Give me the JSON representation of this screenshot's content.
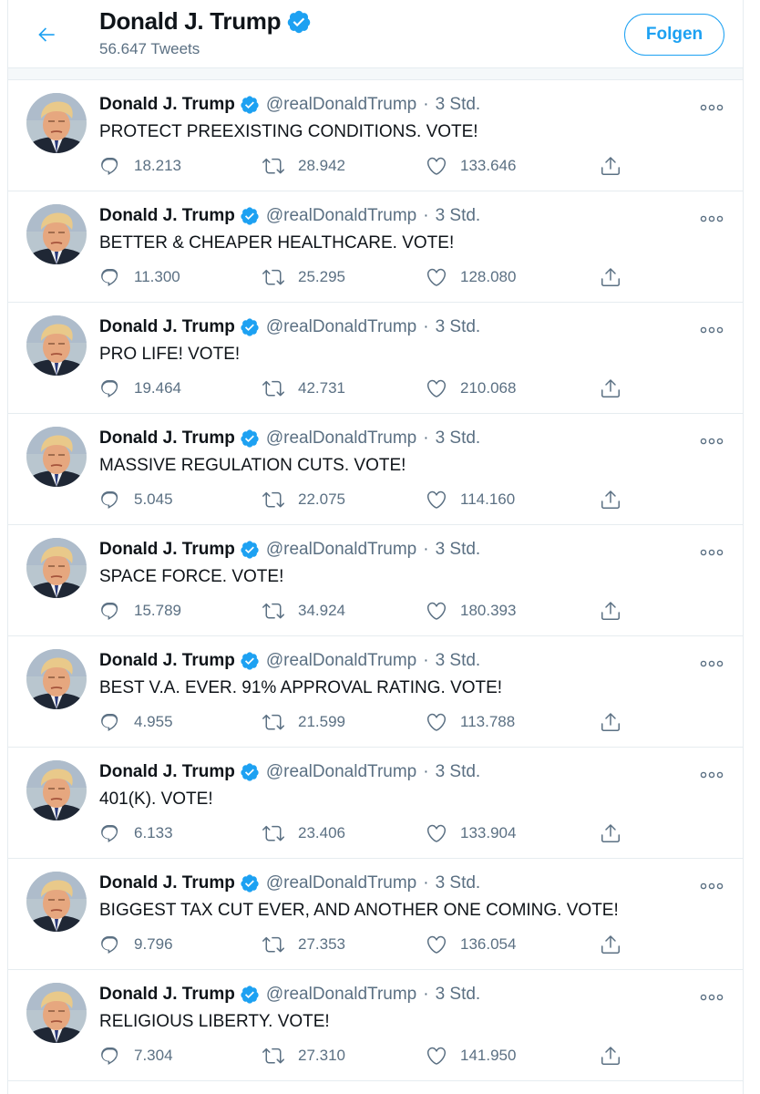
{
  "header": {
    "back_icon": "arrow-left-icon",
    "name": "Donald J. Trump",
    "verified_icon": "verified-badge-icon",
    "tweet_count": "56.647 Tweets",
    "follow_label": "Folgen"
  },
  "colors": {
    "accent": "#1da1f2",
    "text_primary": "#0f1419",
    "text_secondary": "#5b7083",
    "divider": "#e6ecf0"
  },
  "tweets": [
    {
      "name": "Donald J. Trump",
      "handle": "@realDonaldTrump",
      "dot": "·",
      "time": "3 Std.",
      "text": "PROTECT PREEXISTING CONDITIONS. VOTE!",
      "replies": "18.213",
      "retweets": "28.942",
      "likes": "133.646"
    },
    {
      "name": "Donald J. Trump",
      "handle": "@realDonaldTrump",
      "dot": "·",
      "time": "3 Std.",
      "text": "BETTER & CHEAPER HEALTHCARE. VOTE!",
      "replies": "11.300",
      "retweets": "25.295",
      "likes": "128.080"
    },
    {
      "name": "Donald J. Trump",
      "handle": "@realDonaldTrump",
      "dot": "·",
      "time": "3 Std.",
      "text": "PRO LIFE! VOTE!",
      "replies": "19.464",
      "retweets": "42.731",
      "likes": "210.068"
    },
    {
      "name": "Donald J. Trump",
      "handle": "@realDonaldTrump",
      "dot": "·",
      "time": "3 Std.",
      "text": "MASSIVE REGULATION CUTS. VOTE!",
      "replies": "5.045",
      "retweets": "22.075",
      "likes": "114.160"
    },
    {
      "name": "Donald J. Trump",
      "handle": "@realDonaldTrump",
      "dot": "·",
      "time": "3 Std.",
      "text": "SPACE FORCE. VOTE!",
      "replies": "15.789",
      "retweets": "34.924",
      "likes": "180.393"
    },
    {
      "name": "Donald J. Trump",
      "handle": "@realDonaldTrump",
      "dot": "·",
      "time": "3 Std.",
      "text": "BEST V.A. EVER. 91% APPROVAL RATING. VOTE!",
      "replies": "4.955",
      "retweets": "21.599",
      "likes": "113.788"
    },
    {
      "name": "Donald J. Trump",
      "handle": "@realDonaldTrump",
      "dot": "·",
      "time": "3 Std.",
      "text": "401(K). VOTE!",
      "replies": "6.133",
      "retweets": "23.406",
      "likes": "133.904"
    },
    {
      "name": "Donald J. Trump",
      "handle": "@realDonaldTrump",
      "dot": "·",
      "time": "3 Std.",
      "text": "BIGGEST TAX CUT EVER, AND ANOTHER ONE COMING. VOTE!",
      "replies": "9.796",
      "retweets": "27.353",
      "likes": "136.054"
    },
    {
      "name": "Donald J. Trump",
      "handle": "@realDonaldTrump",
      "dot": "·",
      "time": "3 Std.",
      "text": "RELIGIOUS LIBERTY. VOTE!",
      "replies": "7.304",
      "retweets": "27.310",
      "likes": "141.950"
    }
  ],
  "tweet_icons": {
    "avatar": "profile-photo-avatar",
    "more": "more-options-icon",
    "reply": "reply-icon",
    "retweet": "retweet-icon",
    "like": "heart-icon",
    "share": "share-icon"
  }
}
